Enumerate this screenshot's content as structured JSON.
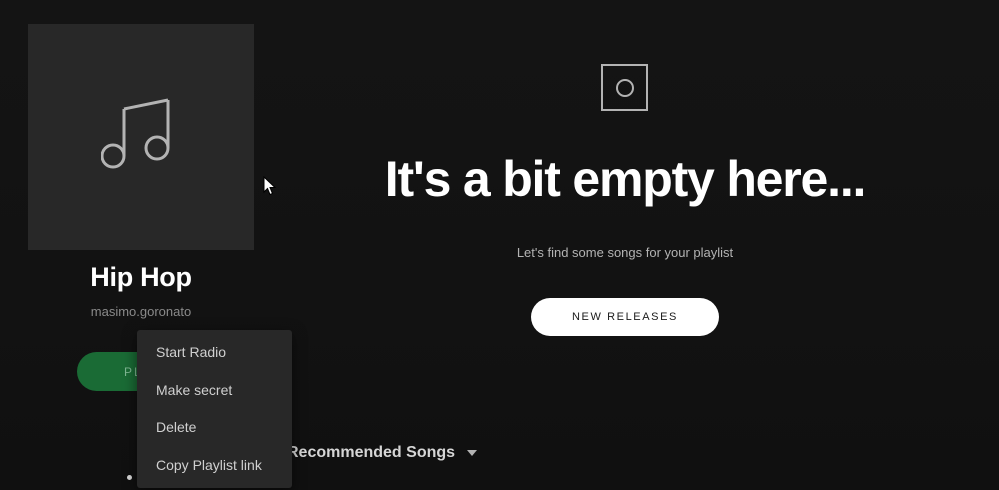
{
  "playlist": {
    "title": "Hip Hop",
    "owner": "masimo.goronato",
    "play_label": "PLAY",
    "cover_icon": "music-note-icon"
  },
  "empty_state": {
    "icon": "empty-box-icon",
    "title": "It's a bit empty here...",
    "subtitle": "Let's find some songs for your playlist",
    "button_label": "NEW RELEASES"
  },
  "recommended": {
    "label": "Recommended Songs",
    "icon": "chevron-down-icon"
  },
  "context_menu": {
    "items": [
      {
        "label": "Start Radio"
      },
      {
        "label": "Make secret"
      },
      {
        "label": "Delete"
      },
      {
        "label": "Copy Playlist link"
      }
    ]
  },
  "colors": {
    "background": "#121212",
    "cover": "#282828",
    "play_button": "#1a6b35",
    "menu_bg": "#282828",
    "primary_text": "#ffffff",
    "secondary_text": "#b3b3b3"
  }
}
